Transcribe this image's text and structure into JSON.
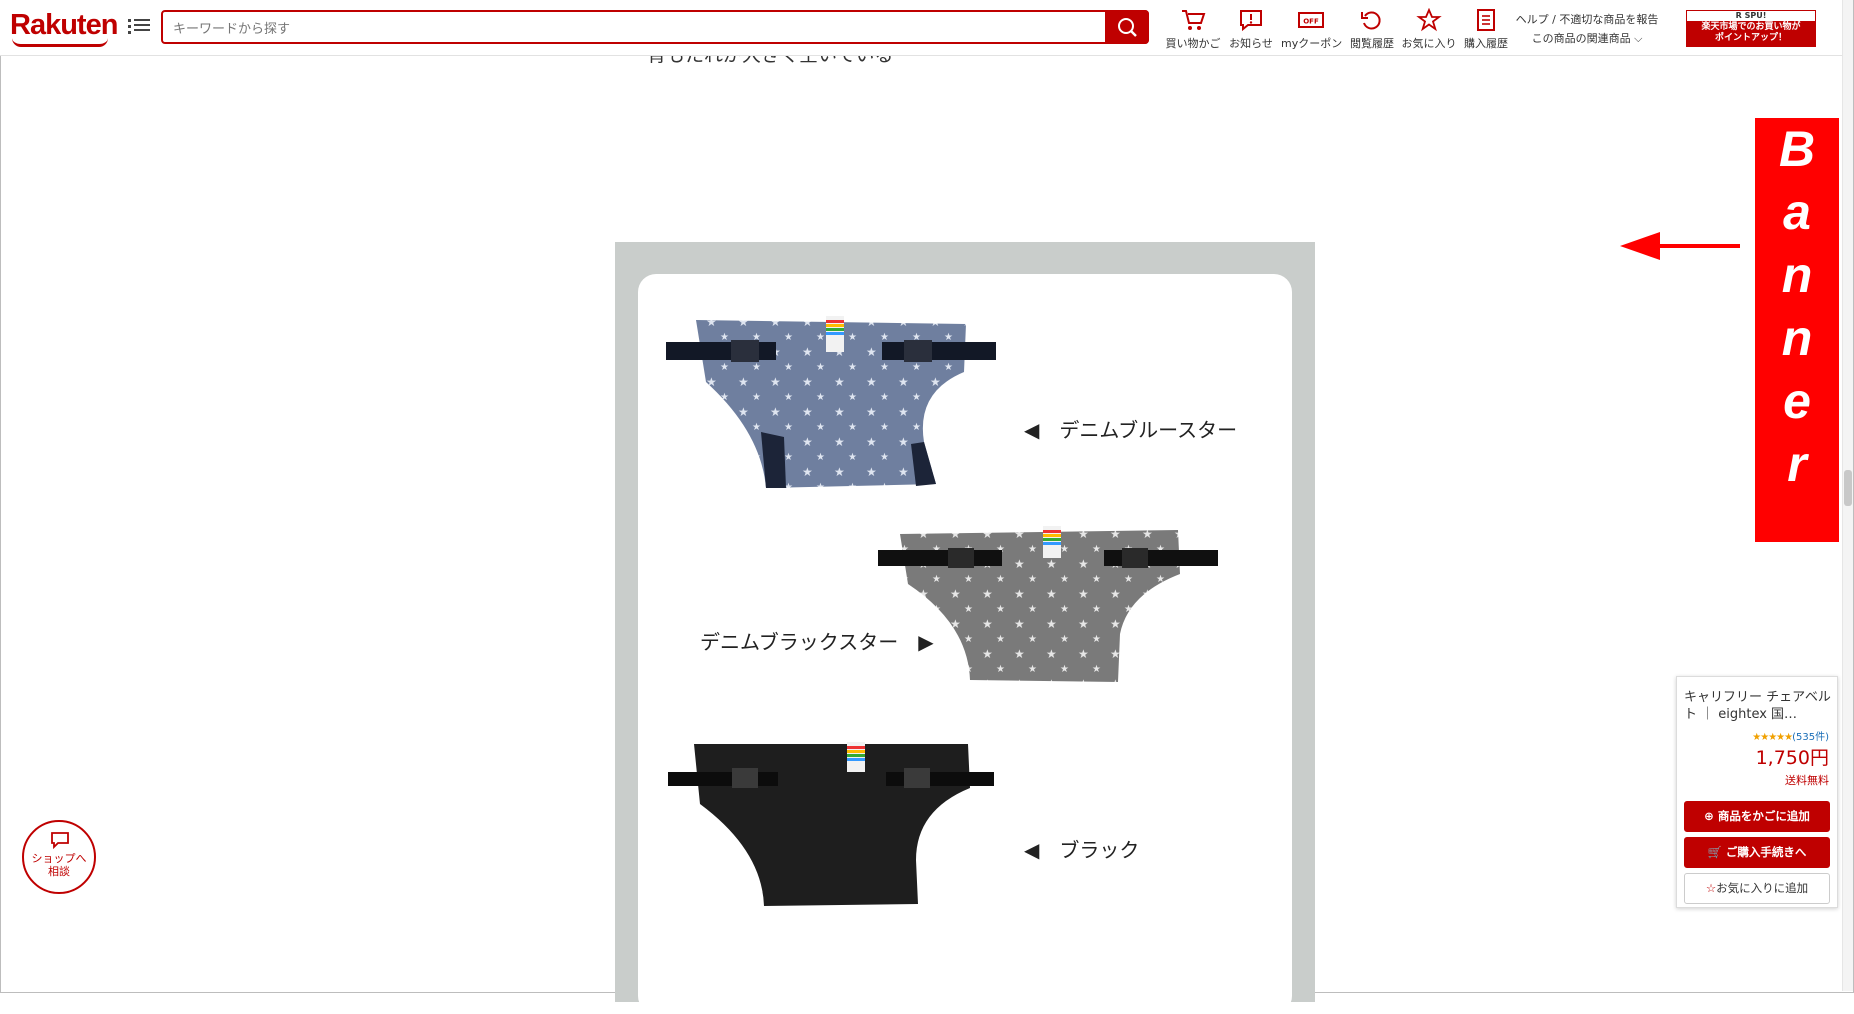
{
  "header": {
    "logo": "Rakuten",
    "search_placeholder": "キーワードから探す",
    "nav": [
      {
        "label": "買い物かご",
        "icon": "cart-icon"
      },
      {
        "label": "お知らせ",
        "icon": "notice-icon"
      },
      {
        "label": "myクーポン",
        "icon": "coupon-icon"
      },
      {
        "label": "閲覧履歴",
        "icon": "history-icon"
      },
      {
        "label": "お気に入り",
        "icon": "star-icon"
      },
      {
        "label": "購入履歴",
        "icon": "receipt-icon"
      }
    ],
    "help_line1": "ヘルプ / 不適切な商品を報告",
    "help_line2": "この商品の関連商品",
    "spu": {
      "top": "R SPU!",
      "line1": "楽天市場でのお買い物が",
      "line2": "ポイントアップ！"
    }
  },
  "content": {
    "cut_text": "・背もたれが大きく空いている",
    "variants": [
      {
        "label": "◀　デニムブルースター"
      },
      {
        "label": "デニムブラックスター　▶"
      },
      {
        "label": "◀　ブラック"
      }
    ]
  },
  "banner": {
    "text": "Banner",
    "color": "#ff0000"
  },
  "consult": {
    "line1": "ショップへ",
    "line2": "相談"
  },
  "floating_cart": {
    "title": "キャリフリー チェアベルト ｜ eightex 国…",
    "stars": "★★★★★",
    "reviews": "(535件)",
    "price": "1,750円",
    "shipping": "送料無料",
    "add_cart": "商品をかごに追加",
    "checkout": "ご購入手続きへ",
    "favorite": "お気に入りに追加"
  },
  "colors": {
    "accent": "#bf0000",
    "panel_bg": "#c9cdcb"
  }
}
